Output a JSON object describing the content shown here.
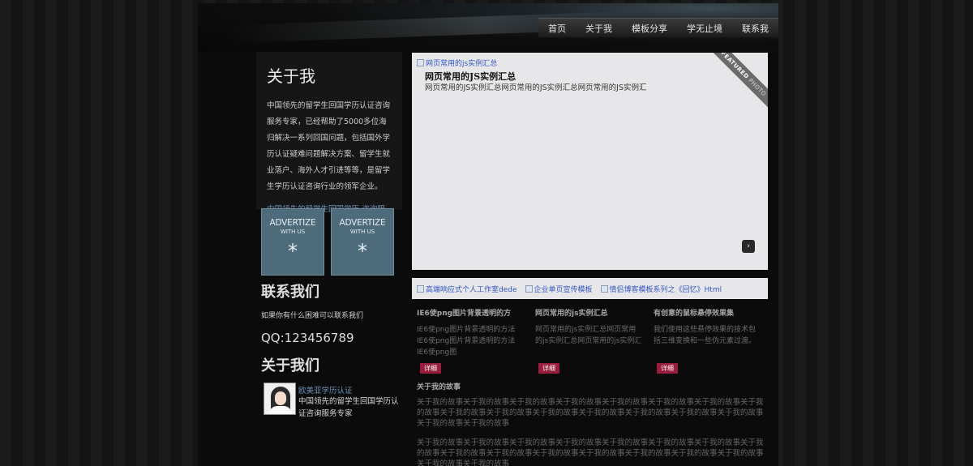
{
  "nav": [
    "首页",
    "关于我",
    "模板分享",
    "学无止境",
    "联系我"
  ],
  "about": {
    "title": "关于我",
    "text": "中国领先的留学生回国学历认证咨询服务专家，已经帮助了5000多位海归解决一系列回国问题，包括国外学历认证疑难问题解决方案、留学生就业落户、海外人才引进等等，是留学生学历认证咨询行业的领军企业。",
    "link": "中国领先的留学生回国学历-咨询服务专家请点击"
  },
  "ads": [
    {
      "big": "ADVERTIZE",
      "small": "WITH US",
      "star": "*"
    },
    {
      "big": "ADVERTIZE",
      "small": "WITH US",
      "star": "*"
    }
  ],
  "contact": {
    "title": "联系我们",
    "text": "如果你有什么困难可以联系我们",
    "qq": "QQ:123456789"
  },
  "about2": {
    "title": "关于我们",
    "name": "欧美亚学历认证",
    "desc": "中国领先的留学生回国学历认证咨询服务专家"
  },
  "featured": {
    "img_alt": "网页常用的js实例汇总",
    "title": "网页常用的JS实例汇总",
    "desc": "网页常用的JS实例汇总网页常用的JS实例汇总网页常用的JS实例汇",
    "ribbon": "FEATURED",
    "ribbon_small": "PHOTO",
    "next": "›"
  },
  "thumbs": [
    "高端响应式个人工作室dede",
    "企业单页宣传模板",
    "情侣博客模板系列之《回忆》Html"
  ],
  "posts": [
    {
      "title": "IE6使png图片背景透明的方",
      "body": "IE6使png图片背景透明的方法IE6使png图片背景透明的方法IE6使png图",
      "more": "详细"
    },
    {
      "title": "网页常用的js实例汇总",
      "body": "网页常用的js实例汇总网页常用的js实例汇总网页常用的js实例汇",
      "more": "详细"
    },
    {
      "title": "有创意的鼠标悬停效果集",
      "body": "我们使用这些悬停效果的技术包括三维变换和一些伪元素过渡。",
      "more": "详细"
    }
  ],
  "story": {
    "title": "关于我的故事",
    "p1": "关于我的故事关于我的故事关于我的故事关于我的故事关于我的故事关于我的故事关于我的故事关于我的故事关于我的故事关于我的故事关于我的故事关于我的故事关于我的故事关于我的故事关于我的故事关于我的故事关于我的故事",
    "p2": "关于我的故事关于我的故事关于我的故事关于我的故事关于我的故事关于我的故事关于我的故事关于我的故事关于我的故事关于我的故事关于我的故事关于我的故事关于我的故事关于我的故事关于我的故事关于我的故事关于我的故事"
  }
}
